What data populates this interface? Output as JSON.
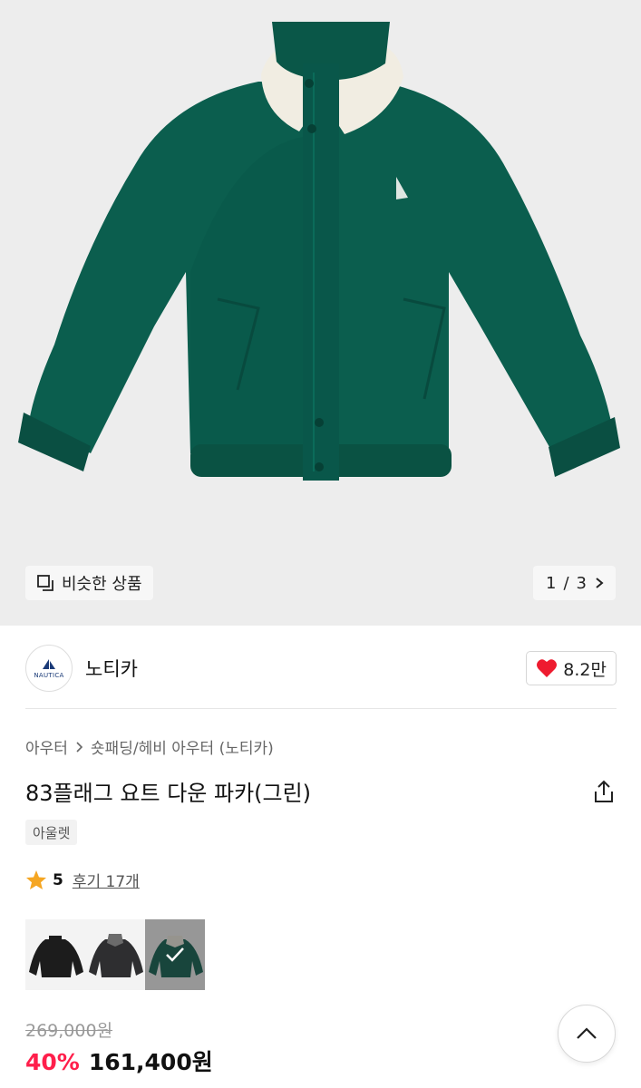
{
  "gallery": {
    "similar_label": "비슷한 상품",
    "page_current": "1",
    "page_separator": "/",
    "page_total": "3",
    "background_color": "#ededed",
    "jacket_color": "#0b5e4e",
    "collar_color": "#f1ede2"
  },
  "brand": {
    "logo_text": "NAUTICA",
    "name": "노티카",
    "like_count": "8.2만",
    "like_icon_color": "#ee1b2f"
  },
  "breadcrumb": {
    "level1": "아우터",
    "level2": "숏패딩/헤비 아우터 (노티카)"
  },
  "product": {
    "title": "83플래그 요트 다운 파카(그린)",
    "tag": "아울렛"
  },
  "rating": {
    "score": "5",
    "reviews_label": "후기 17개",
    "star_color": "#f5a623"
  },
  "options": [
    {
      "name": "black",
      "color": "#1c1c1c",
      "selected": false
    },
    {
      "name": "charcoal",
      "color": "#2e2e30",
      "selected": false
    },
    {
      "name": "green",
      "color": "#0b5e4e",
      "selected": true
    }
  ],
  "price": {
    "original": "269,000원",
    "discount": "40%",
    "sale": "161,400원",
    "discount_color": "#ff1f4b"
  }
}
